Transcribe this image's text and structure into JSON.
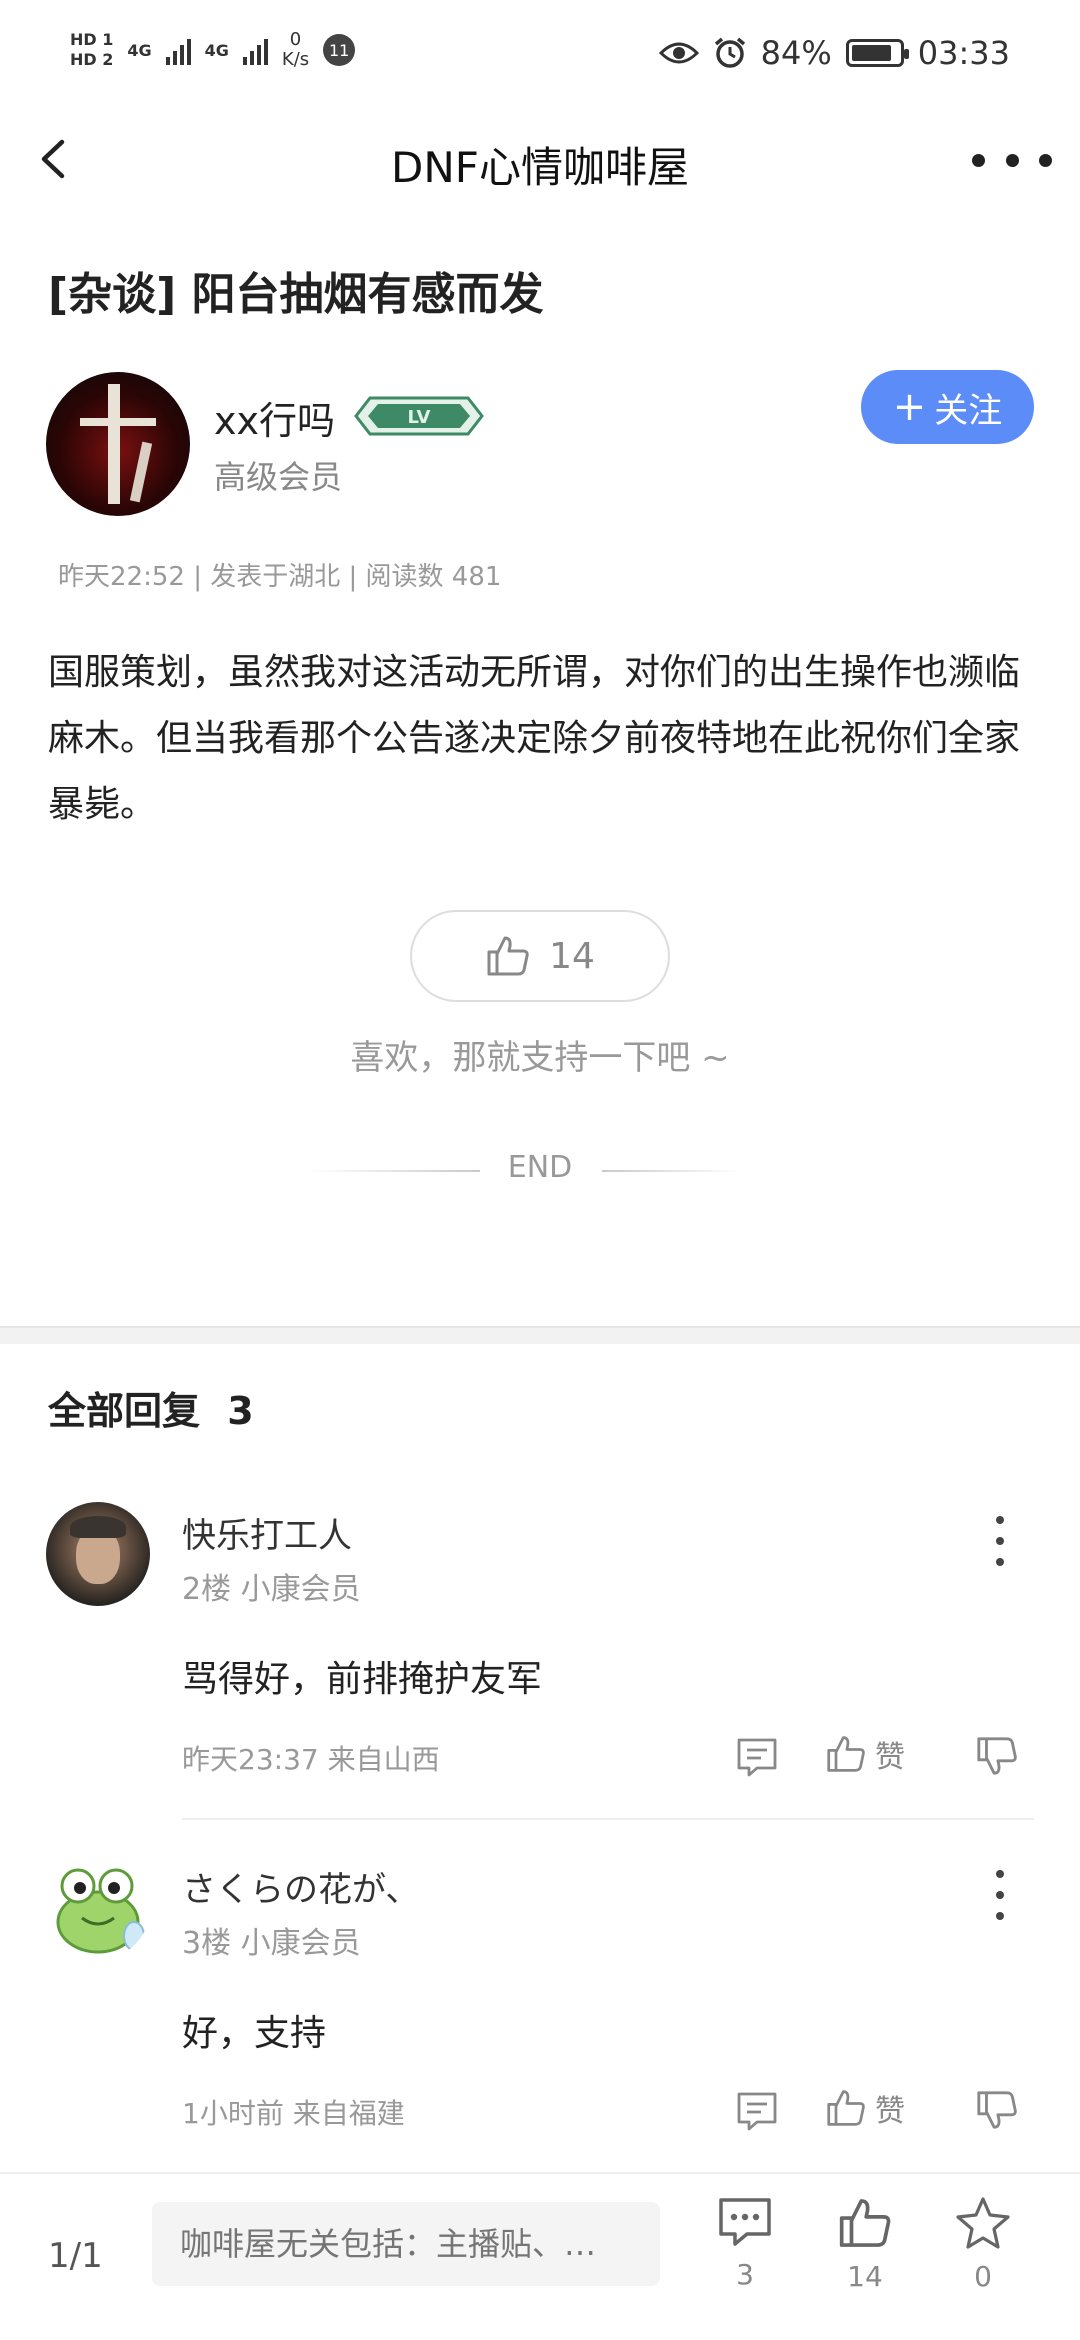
{
  "status_bar": {
    "hd1": "HD 1",
    "hd2": "HD 2",
    "net1": "4G",
    "net2": "4G",
    "speed_value": "0",
    "speed_unit": "K/s",
    "badge": "11",
    "battery_percent": "84%",
    "battery_level": 0.84,
    "time": "03:33",
    "icons": [
      "eye-icon",
      "alarm-icon",
      "battery-icon"
    ]
  },
  "nav": {
    "title": "DNF心情咖啡屋",
    "back_icon": "chevron-left-icon",
    "more_icon": "more-horizontal-icon"
  },
  "post": {
    "title": "[杂谈] 阳台抽烟有感而发",
    "author": {
      "name": "xx行吗",
      "badge_text": "LV",
      "role": "高级会员"
    },
    "follow_label": "关注",
    "meta": "昨天22:52 | 发表于湖北 | 阅读数 481",
    "body": "国服策划，虽然我对这活动无所谓，对你们的出生操作也濒临麻木。但当我看那个公告遂决定除夕前夜特地在此祝你们全家暴毙。",
    "like_count": "14",
    "like_hint": "喜欢，那就支持一下吧 ~",
    "end_label": "END"
  },
  "replies": {
    "title": "全部回复",
    "count": "3",
    "items": [
      {
        "name": "快乐打工人",
        "sub": "2楼 小康会员",
        "text": "骂得好，前排掩护友军",
        "time": "昨天23:37 来自山西",
        "like_label": "赞"
      },
      {
        "name": "さくらの花が、",
        "sub": "3楼 小康会员",
        "text": "好，支持",
        "time": "1小时前 来自福建",
        "like_label": "赞"
      }
    ]
  },
  "bottom_bar": {
    "page": "1/1",
    "input_placeholder": "咖啡屋无关包括：主播贴、…",
    "comment_count": "3",
    "like_count": "14",
    "fav_count": "0"
  },
  "colors": {
    "accent": "#5b8cf7",
    "badge_green": "#3e8a66"
  }
}
